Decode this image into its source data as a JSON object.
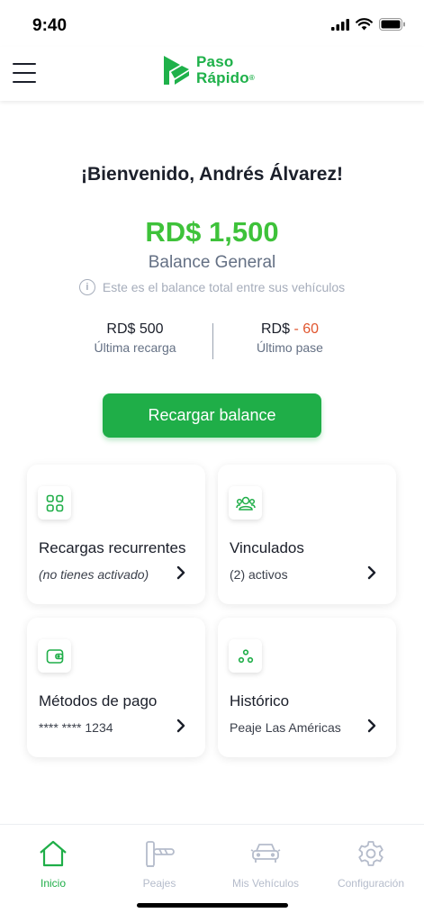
{
  "status_bar": {
    "time": "9:40"
  },
  "header": {
    "logo_line1": "Paso",
    "logo_line2": "Rápido"
  },
  "welcome": {
    "greeting": "¡Bienvenido, Andrés Álvarez!"
  },
  "balance": {
    "amount": "RD$ 1,500",
    "label": "Balance General",
    "info": "Este es el balance total entre sus vehículos"
  },
  "stats": {
    "last_recharge_value": "RD$ 500",
    "last_recharge_label": "Última recarga",
    "last_pass_currency": "RD$",
    "last_pass_amount": "- 60",
    "last_pass_label": "Último pase"
  },
  "recharge_button": {
    "label": "Recargar balance"
  },
  "cards": {
    "recurring": {
      "title": "Recargas recurrentes",
      "subtitle": "(no tienes activado)",
      "icon": "grid-icon"
    },
    "linked": {
      "title": "Vinculados",
      "subtitle": "(2) activos",
      "icon": "users-icon"
    },
    "payment": {
      "title": "Métodos de pago",
      "subtitle": "**** **** 1234",
      "icon": "wallet-icon"
    },
    "history": {
      "title": "Histórico",
      "subtitle": "Peaje Las Américas",
      "icon": "history-icon"
    }
  },
  "bottom_nav": {
    "items": [
      {
        "label": "Inicio",
        "icon": "home-icon",
        "active": true
      },
      {
        "label": "Peajes",
        "icon": "toll-barrier-icon"
      },
      {
        "label": "Mis Vehículos",
        "icon": "car-icon"
      },
      {
        "label": "Configuración",
        "icon": "gear-icon"
      }
    ]
  },
  "colors": {
    "brand_green": "#1fae48",
    "balance_green": "#3ec23a",
    "negative": "#e0552e",
    "muted": "#647084"
  }
}
